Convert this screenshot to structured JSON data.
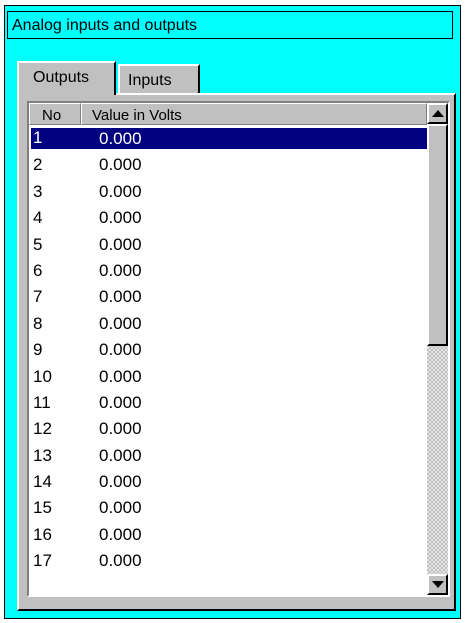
{
  "panel": {
    "title": "Analog inputs and outputs"
  },
  "tabs": [
    {
      "label": "Outputs",
      "active": true
    },
    {
      "label": "Inputs",
      "active": false
    }
  ],
  "table": {
    "columns": [
      "No",
      "Value in Volts"
    ],
    "selected_row": 0,
    "rows": [
      {
        "no": "1",
        "value": "0.000"
      },
      {
        "no": "2",
        "value": "0.000"
      },
      {
        "no": "3",
        "value": "0.000"
      },
      {
        "no": "4",
        "value": "0.000"
      },
      {
        "no": "5",
        "value": "0.000"
      },
      {
        "no": "6",
        "value": "0.000"
      },
      {
        "no": "7",
        "value": "0.000"
      },
      {
        "no": "8",
        "value": "0.000"
      },
      {
        "no": "9",
        "value": "0.000"
      },
      {
        "no": "10",
        "value": "0.000"
      },
      {
        "no": "11",
        "value": "0.000"
      },
      {
        "no": "12",
        "value": "0.000"
      },
      {
        "no": "13",
        "value": "0.000"
      },
      {
        "no": "14",
        "value": "0.000"
      },
      {
        "no": "15",
        "value": "0.000"
      },
      {
        "no": "16",
        "value": "0.000"
      },
      {
        "no": "17",
        "value": "0.000"
      }
    ]
  },
  "scrollbar": {
    "up_icon": "arrow-up-icon",
    "down_icon": "arrow-down-icon"
  },
  "colors": {
    "panel_background": "#00ffff",
    "selection": "#000080",
    "face": "#c0c0c0"
  }
}
